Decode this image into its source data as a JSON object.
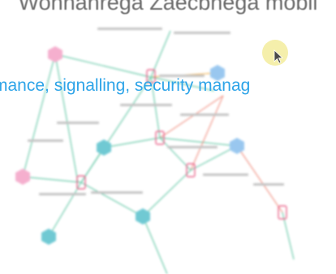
{
  "caption_top": "Wohnahrega Zaecbhega mobil",
  "caption_mid": "mance, signalling, security manag",
  "colors": {
    "background": "#ffffff",
    "caption_top": "#6b6b6b",
    "caption_mid": "#2ea4e8",
    "node_pink": "#f4a7c9",
    "node_blue": "#8fc2ee",
    "node_teal": "#61c4cf",
    "node_device": "#e7547e",
    "edge_green": "#58c4a0",
    "edge_red": "#f08a7a",
    "edge_orange": "#f5b04a",
    "cursor_highlight": "#f3ec9c"
  },
  "icons": {
    "graph_node_shape": "hexagon-icon",
    "device_node_shape": "mobile-device-icon",
    "pointer": "mouse-pointer-icon"
  }
}
